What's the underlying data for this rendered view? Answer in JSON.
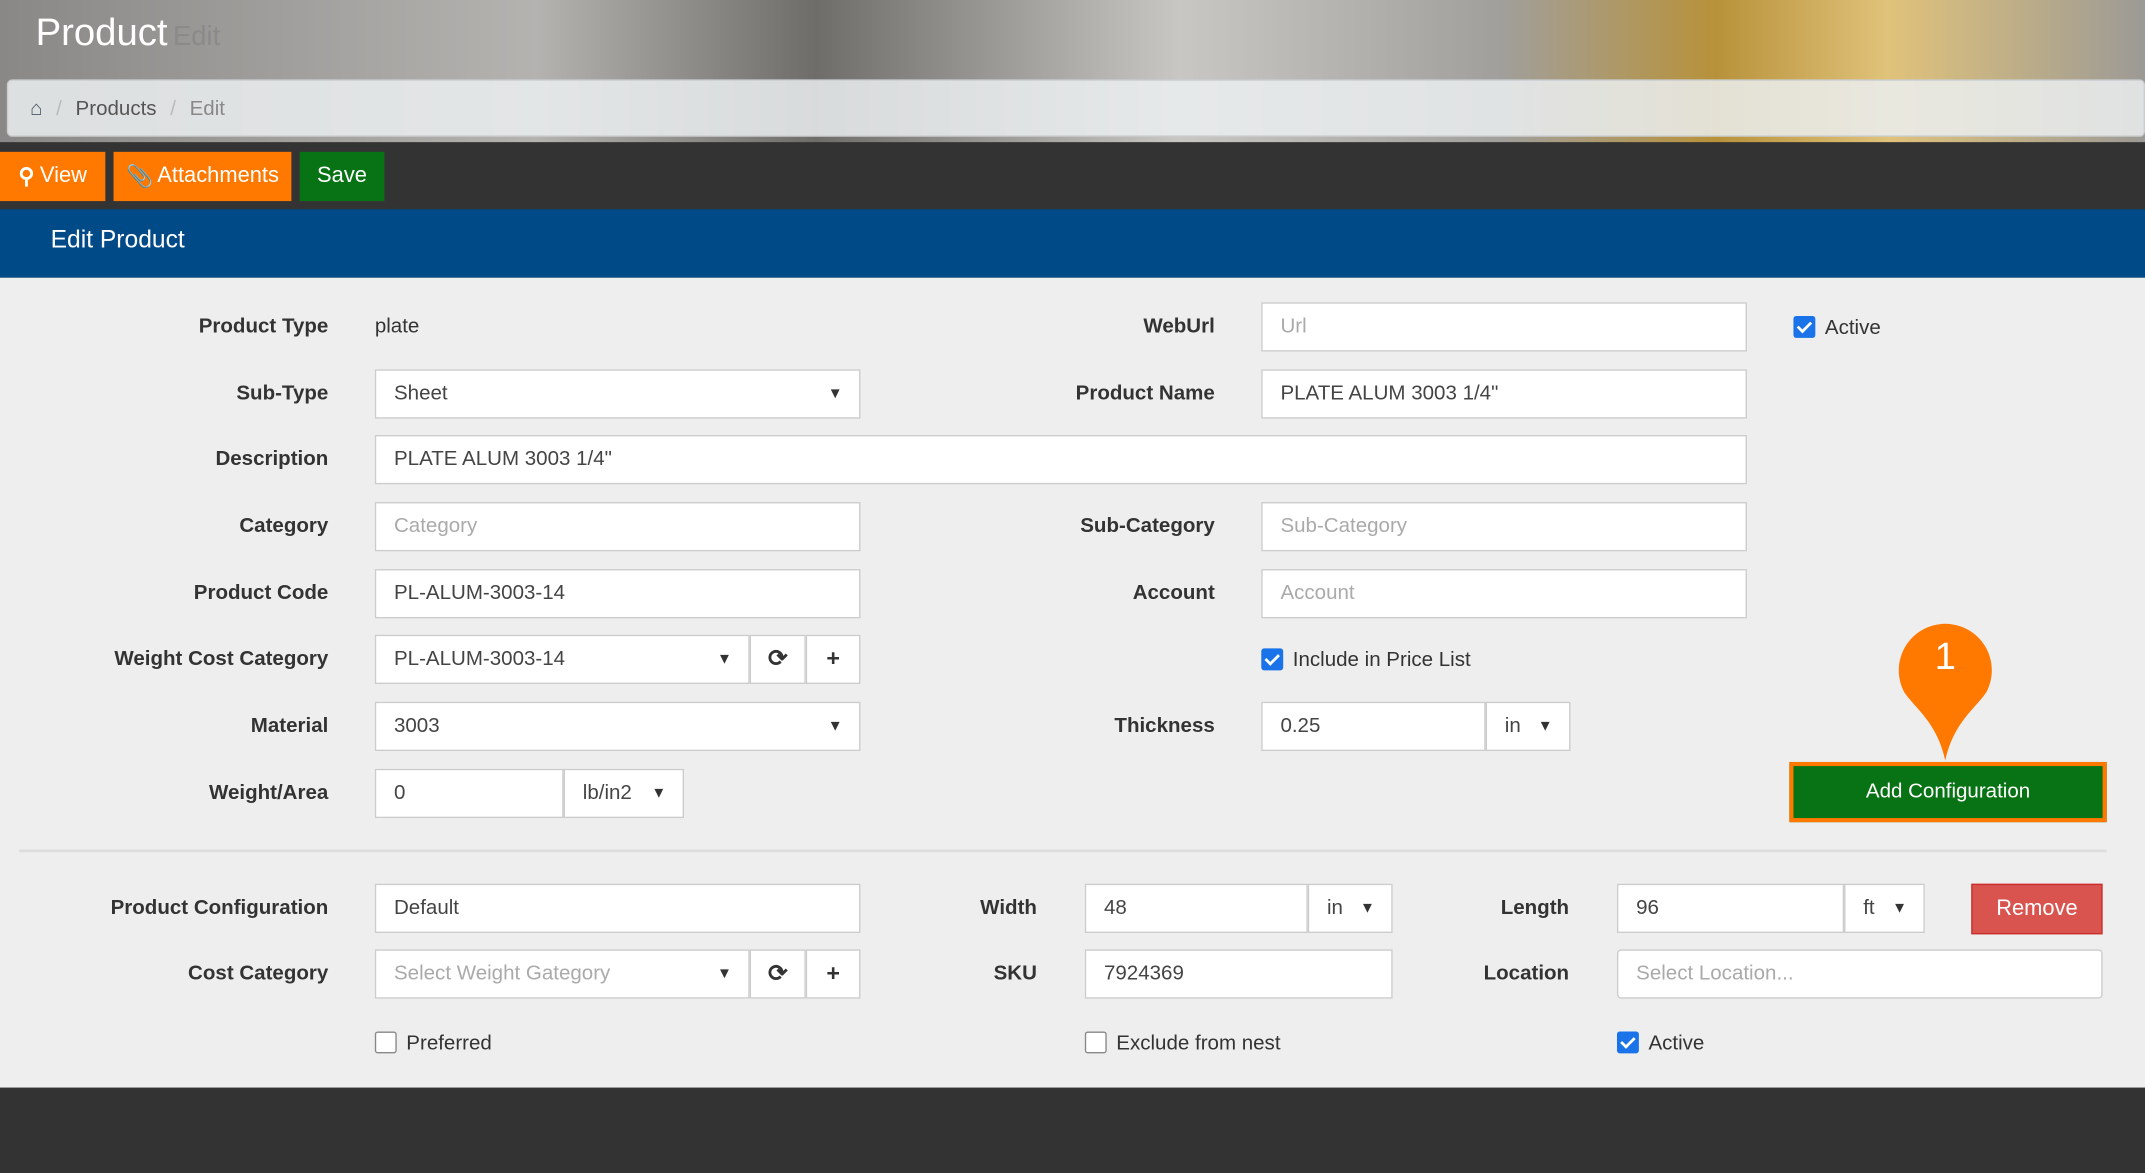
{
  "header": {
    "title": "Product",
    "subtitle": "Edit"
  },
  "breadcrumb": {
    "items": [
      "Products",
      "Edit"
    ]
  },
  "toolbar": {
    "view": "View",
    "attachments": "Attachments",
    "save": "Save"
  },
  "panel": {
    "title": "Edit Product"
  },
  "form": {
    "product_type": {
      "label": "Product Type",
      "value": "plate"
    },
    "weburl": {
      "label": "WebUrl",
      "placeholder": "Url"
    },
    "active": {
      "label": "Active",
      "checked": true
    },
    "sub_type": {
      "label": "Sub-Type",
      "value": "Sheet"
    },
    "product_name": {
      "label": "Product Name",
      "value": "PLATE ALUM 3003 1/4\""
    },
    "description": {
      "label": "Description",
      "value": "PLATE ALUM 3003 1/4\""
    },
    "category": {
      "label": "Category",
      "placeholder": "Category"
    },
    "sub_category": {
      "label": "Sub-Category",
      "placeholder": "Sub-Category"
    },
    "product_code": {
      "label": "Product Code",
      "value": "PL-ALUM-3003-14"
    },
    "account": {
      "label": "Account",
      "placeholder": "Account"
    },
    "weight_cost_category": {
      "label": "Weight Cost Category",
      "value": "PL-ALUM-3003-14"
    },
    "include_price_list": {
      "label": "Include in Price List",
      "checked": true
    },
    "material": {
      "label": "Material",
      "value": "3003"
    },
    "thickness": {
      "label": "Thickness",
      "value": "0.25",
      "unit": "in"
    },
    "weight_area": {
      "label": "Weight/Area",
      "value": "0",
      "unit": "lb/in2"
    },
    "add_configuration": "Add Configuration",
    "callout_number": "1"
  },
  "config": {
    "product_configuration": {
      "label": "Product Configuration",
      "value": "Default"
    },
    "width": {
      "label": "Width",
      "value": "48",
      "unit": "in"
    },
    "length": {
      "label": "Length",
      "value": "96",
      "unit": "ft"
    },
    "remove": "Remove",
    "cost_category": {
      "label": "Cost Category",
      "placeholder": "Select Weight Gategory"
    },
    "sku": {
      "label": "SKU",
      "value": "7924369"
    },
    "location": {
      "label": "Location",
      "placeholder": "Select Location..."
    },
    "preferred": {
      "label": "Preferred",
      "checked": false
    },
    "exclude_nest": {
      "label": "Exclude from nest",
      "checked": false
    },
    "active": {
      "label": "Active",
      "checked": true
    }
  },
  "colors": {
    "orange": "#ff7800",
    "green": "#087315",
    "blue": "#004a87",
    "red": "#d9534f"
  }
}
